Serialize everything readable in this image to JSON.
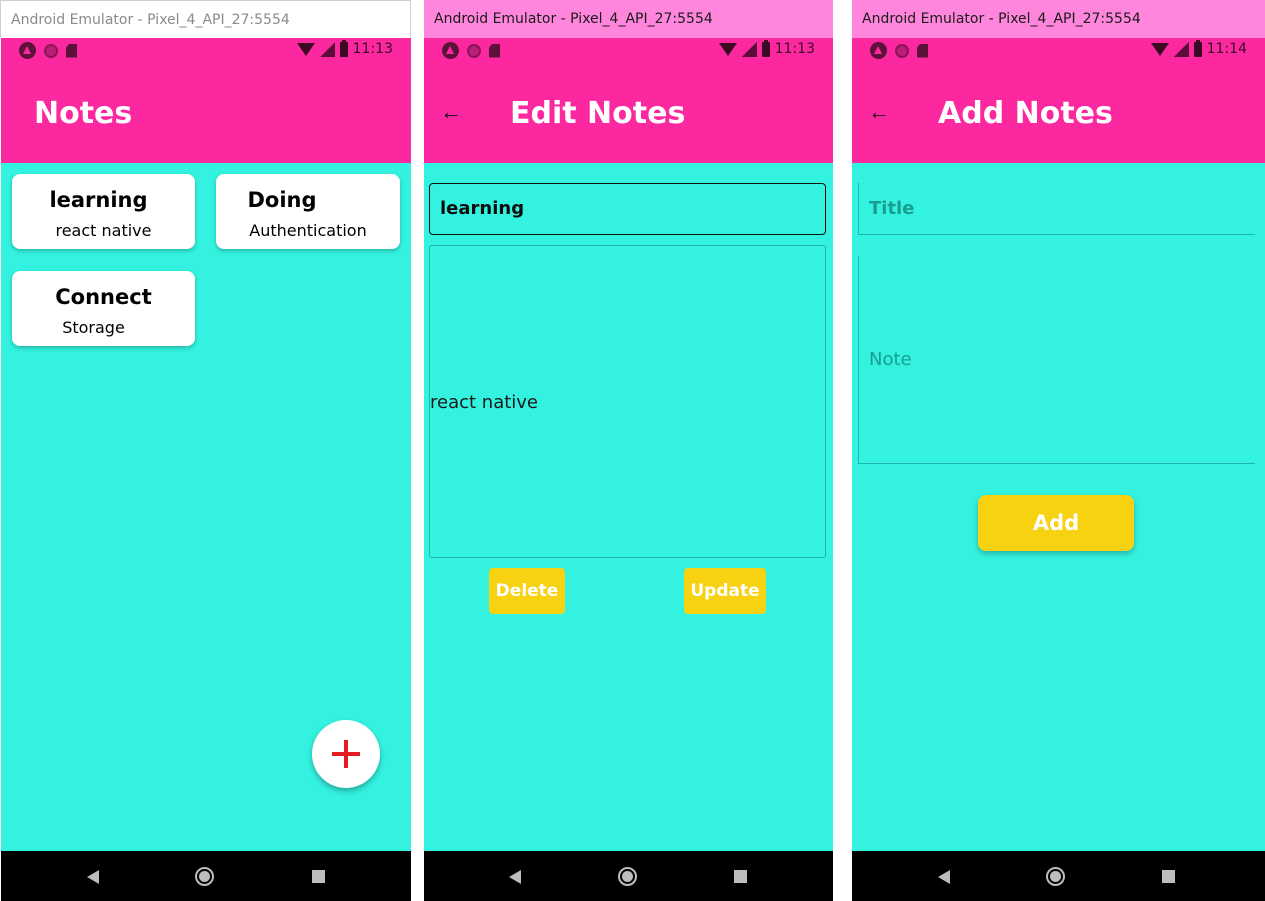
{
  "colors": {
    "background": "#33f2e0",
    "appbar": "#fc28a0",
    "button": "#f7d210",
    "fab_plus": "#e51c23"
  },
  "window1": {
    "title": "Android Emulator - Pixel_4_API_27:5554",
    "time": "11:13",
    "header": "Notes",
    "notes": [
      {
        "title": "learning",
        "body": "react native"
      },
      {
        "title": "Doing",
        "body": "Authentication"
      },
      {
        "title": "Connect",
        "body": "Storage"
      }
    ],
    "fab_icon": "plus-icon"
  },
  "window2": {
    "title": "Android Emulator - Pixel_4_API_27:5554",
    "time": "11:13",
    "header": "Edit Notes",
    "back_icon": "back-arrow-icon",
    "title_value": "learning",
    "note_value": "react native",
    "delete_label": "Delete",
    "update_label": "Update"
  },
  "window3": {
    "title": "Android Emulator - Pixel_4_API_27:5554",
    "time": "11:14",
    "header": "Add Notes",
    "back_icon": "back-arrow-icon",
    "title_placeholder": "Title",
    "note_placeholder": "Note",
    "add_label": "Add"
  },
  "nav_icons": [
    "back-icon",
    "home-icon",
    "recents-icon"
  ]
}
